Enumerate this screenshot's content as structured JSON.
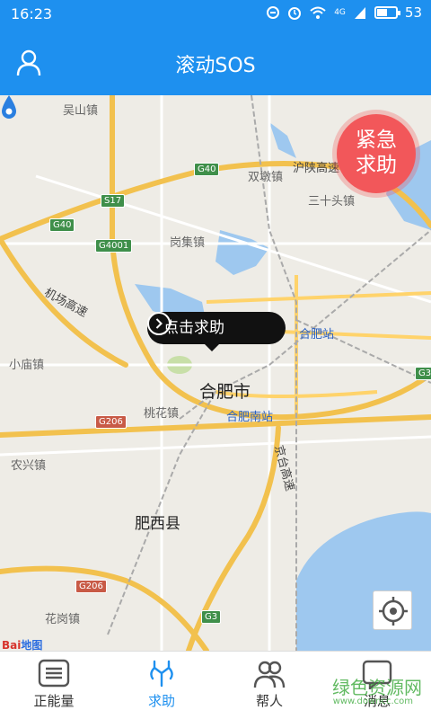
{
  "status": {
    "time": "16:23",
    "battery": "53",
    "battery_level": 0.53,
    "network": "4G"
  },
  "header": {
    "title": "滚动SOS"
  },
  "sos": {
    "line1": "紧急",
    "line2": "求助"
  },
  "callout": {
    "label": "点击求助"
  },
  "map": {
    "places": {
      "wushan": "吴山镇",
      "shuangdun": "双墩镇",
      "shishitou": "三十头镇",
      "gangji": "岗集镇",
      "hefei_station": "合肥站",
      "xiaomiao": "小庙镇",
      "hefei_city": "合肥市",
      "taohua": "桃花镇",
      "hefei_south": "合肥南站",
      "nongxing": "农兴镇",
      "feixi": "肥西县",
      "huagang": "花岗镇"
    },
    "roads": {
      "g40_a": "G40",
      "g40_b": "G40",
      "s17": "S17",
      "g4001": "G4001",
      "g206_a": "G206",
      "g206_b": "G206",
      "g3": "G3",
      "g3_edge": "G3",
      "airport_expwy": "机场高速",
      "hushaan_expwy": "沪陕高速",
      "jingtai_expwy": "京台高速"
    },
    "logo_main": "Bai",
    "logo_sub": "地图"
  },
  "nav": {
    "items": [
      {
        "label": "正能量",
        "icon": "list-icon"
      },
      {
        "label": "求助",
        "icon": "help-icon"
      },
      {
        "label": "帮人",
        "icon": "people-icon"
      },
      {
        "label": "消息",
        "icon": "message-icon"
      }
    ],
    "active_index": 1
  },
  "watermark": {
    "text": "绿色资源网",
    "url": "www.downcc.com"
  },
  "colors": {
    "primary": "#1e90ef",
    "sos": "#f2575a",
    "road": "#f2c14e",
    "water": "#9ec8ef",
    "map_bg": "#eeece6"
  }
}
